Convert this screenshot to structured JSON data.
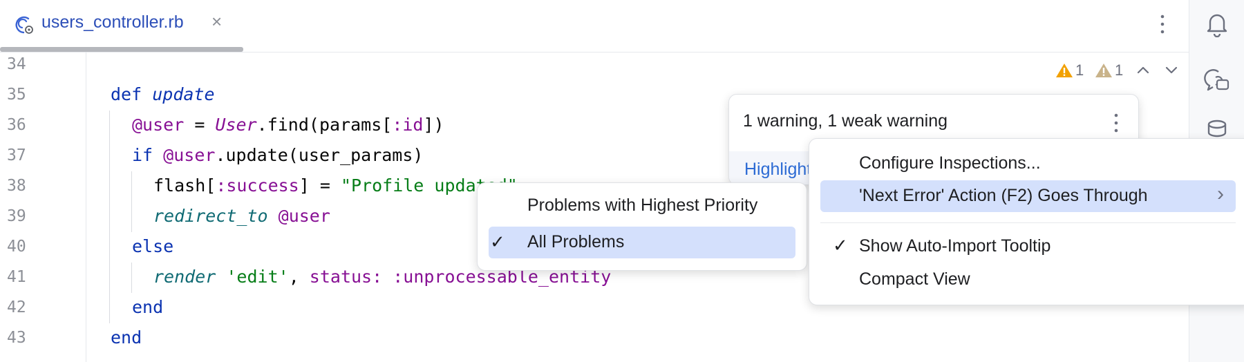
{
  "editor_tab": {
    "filename": "users_controller.rb",
    "close_glyph": "×",
    "icon": "ruby-controller-icon"
  },
  "toolbar": {
    "more_icon": "more-vertical-icon"
  },
  "tool_window_bar": [
    {
      "name": "notifications-bell-icon"
    },
    {
      "name": "ai-assistant-icon"
    },
    {
      "name": "database-icon"
    }
  ],
  "line_numbers": [
    "34",
    "35",
    "36",
    "37",
    "38",
    "39",
    "40",
    "41",
    "42",
    "43"
  ],
  "code": {
    "l35": {
      "kw": "def",
      "name": "update"
    },
    "l36": {
      "ivar": "@user",
      "eq": " = ",
      "const": "User",
      "rest1": ".find(params[",
      "sym": ":id",
      "rest2": "])"
    },
    "l37": {
      "kw": "if",
      "ivar": "@user",
      "rest": ".update(user_params)"
    },
    "l38": {
      "text1": "flash[",
      "sym": ":success",
      "text2": "] = ",
      "str": "\"Profile updated\""
    },
    "l39": {
      "call": "redirect_to",
      "ivar": "@user"
    },
    "l40": {
      "kw": "else"
    },
    "l41": {
      "call": "render",
      "str": "'edit'",
      "comma": ", ",
      "key": "status:",
      "sym": ":unprocessable_entity"
    },
    "l42": {
      "kw": "end"
    },
    "l43": {
      "kw": "end"
    }
  },
  "inspection_widget": {
    "warnings_count": "1",
    "weak_warnings_count": "1",
    "warning_color": "#f2a100",
    "weak_warning_color": "#c9b38a"
  },
  "problems_popup": {
    "title": "1 warning, 1 weak warning",
    "link_text": "Highlight"
  },
  "context_menu": {
    "items": [
      {
        "label": "Configure Inspections...",
        "checked": false
      },
      {
        "label": "'Next Error' Action (F2) Goes Through",
        "checked": false,
        "submenu": true,
        "selected": true
      },
      {
        "label": "Show Auto-Import Tooltip",
        "checked": true
      },
      {
        "label": "Compact View",
        "checked": false
      }
    ],
    "check_glyph": "✓",
    "submenu_glyph": "›"
  },
  "submenu": {
    "items": [
      {
        "label": "Problems with Highest Priority",
        "checked": false
      },
      {
        "label": "All Problems",
        "checked": true,
        "selected": true
      }
    ]
  },
  "colors": {
    "accent": "#2d4fb8",
    "selection": "#d4e0fc"
  }
}
